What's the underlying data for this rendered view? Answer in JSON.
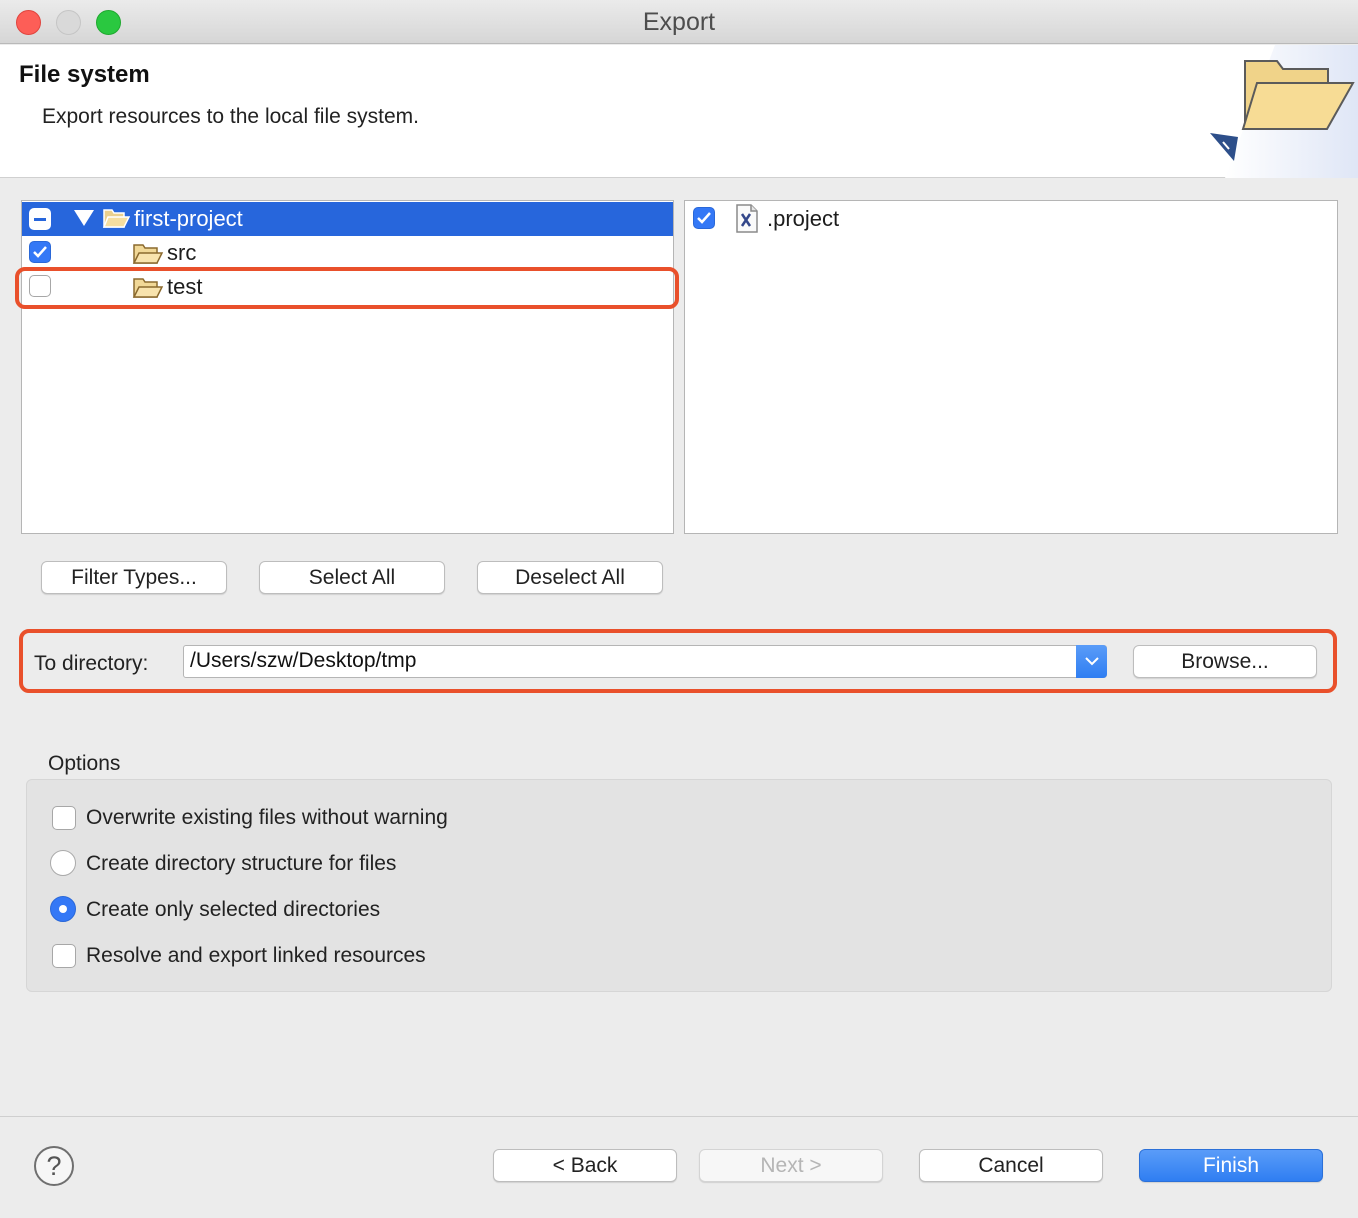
{
  "window": {
    "title": "Export"
  },
  "header": {
    "title": "File system",
    "description": "Export resources to the local file system."
  },
  "tree": {
    "items": [
      {
        "label": "first-project",
        "state": "mixed",
        "expanded": true,
        "selected": true
      },
      {
        "label": "src",
        "state": "checked"
      },
      {
        "label": "test",
        "state": "unchecked"
      }
    ]
  },
  "files": {
    "items": [
      {
        "label": ".project",
        "state": "checked"
      }
    ]
  },
  "selection_buttons": {
    "filter": "Filter Types...",
    "select_all": "Select All",
    "deselect_all": "Deselect All"
  },
  "destination": {
    "label": "To directory:",
    "value": "/Users/szw/Desktop/tmp",
    "browse": "Browse..."
  },
  "options": {
    "title": "Options",
    "overwrite": {
      "label": "Overwrite existing files without warning",
      "checked": false
    },
    "create_structure": {
      "label": "Create directory structure for files",
      "selected": false
    },
    "create_selected": {
      "label": "Create only selected directories",
      "selected": true
    },
    "resolve_linked": {
      "label": "Resolve and export linked resources",
      "checked": false
    }
  },
  "footer": {
    "help": "?",
    "back": "< Back",
    "next": "Next >",
    "cancel": "Cancel",
    "finish": "Finish"
  },
  "colors": {
    "accent": "#2766dc",
    "highlight": "#e9502b"
  }
}
